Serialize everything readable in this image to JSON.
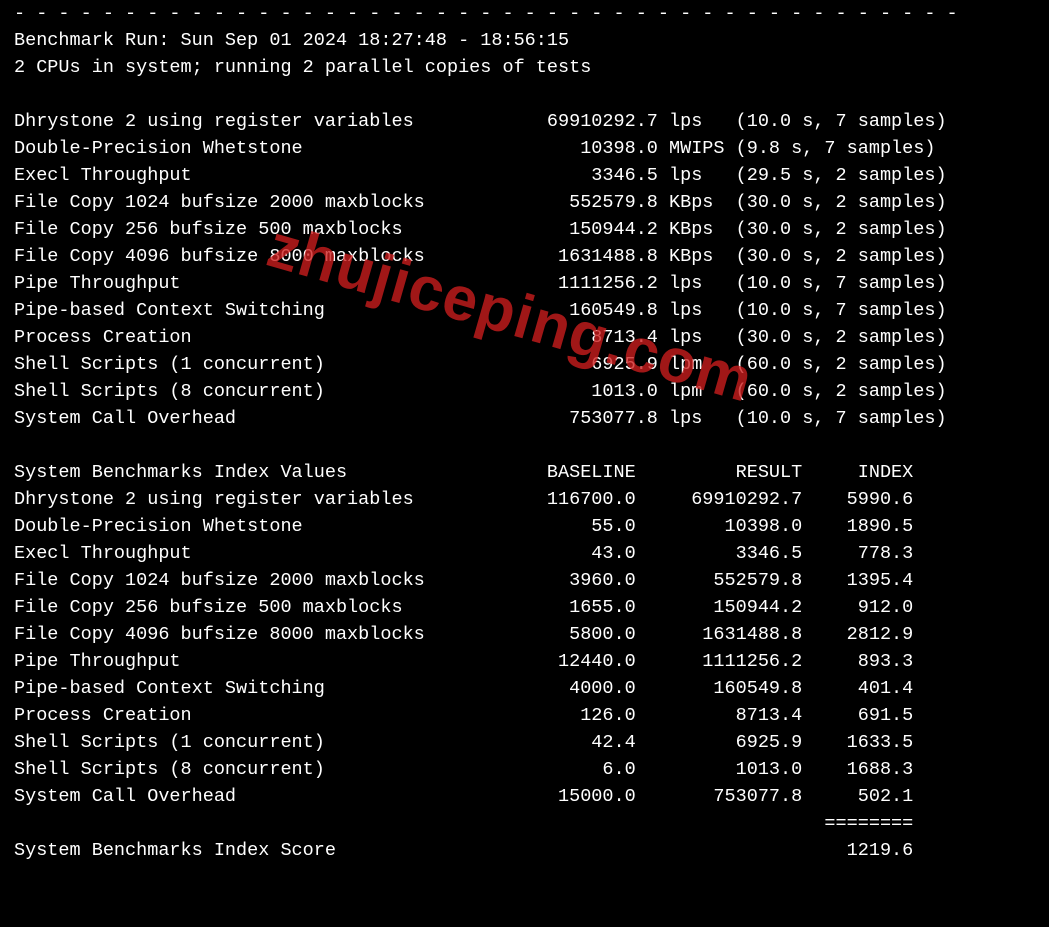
{
  "watermark": "zhujiceping.com",
  "dashes": "- - - - - - - - - - - - - - - - - - - - - - - - - - - - - - - - - - - - - - - - - - -",
  "header": {
    "run_line": "Benchmark Run: Sun Sep 01 2024 18:27:48 - 18:56:15",
    "cpu_line": "2 CPUs in system; running 2 parallel copies of tests"
  },
  "tests": [
    {
      "name": "Dhrystone 2 using register variables",
      "value": "69910292.7",
      "unit": "lps",
      "meta": "(10.0 s, 7 samples)"
    },
    {
      "name": "Double-Precision Whetstone",
      "value": "10398.0",
      "unit": "MWIPS",
      "meta": "(9.8 s, 7 samples)"
    },
    {
      "name": "Execl Throughput",
      "value": "3346.5",
      "unit": "lps",
      "meta": "(29.5 s, 2 samples)"
    },
    {
      "name": "File Copy 1024 bufsize 2000 maxblocks",
      "value": "552579.8",
      "unit": "KBps",
      "meta": "(30.0 s, 2 samples)"
    },
    {
      "name": "File Copy 256 bufsize 500 maxblocks",
      "value": "150944.2",
      "unit": "KBps",
      "meta": "(30.0 s, 2 samples)"
    },
    {
      "name": "File Copy 4096 bufsize 8000 maxblocks",
      "value": "1631488.8",
      "unit": "KBps",
      "meta": "(30.0 s, 2 samples)"
    },
    {
      "name": "Pipe Throughput",
      "value": "1111256.2",
      "unit": "lps",
      "meta": "(10.0 s, 7 samples)"
    },
    {
      "name": "Pipe-based Context Switching",
      "value": "160549.8",
      "unit": "lps",
      "meta": "(10.0 s, 7 samples)"
    },
    {
      "name": "Process Creation",
      "value": "8713.4",
      "unit": "lps",
      "meta": "(30.0 s, 2 samples)"
    },
    {
      "name": "Shell Scripts (1 concurrent)",
      "value": "6925.9",
      "unit": "lpm",
      "meta": "(60.0 s, 2 samples)"
    },
    {
      "name": "Shell Scripts (8 concurrent)",
      "value": "1013.0",
      "unit": "lpm",
      "meta": "(60.0 s, 2 samples)"
    },
    {
      "name": "System Call Overhead",
      "value": "753077.8",
      "unit": "lps",
      "meta": "(10.0 s, 7 samples)"
    }
  ],
  "index_header": {
    "title": "System Benchmarks Index Values",
    "col1": "BASELINE",
    "col2": "RESULT",
    "col3": "INDEX"
  },
  "index_rows": [
    {
      "name": "Dhrystone 2 using register variables",
      "baseline": "116700.0",
      "result": "69910292.7",
      "index": "5990.6"
    },
    {
      "name": "Double-Precision Whetstone",
      "baseline": "55.0",
      "result": "10398.0",
      "index": "1890.5"
    },
    {
      "name": "Execl Throughput",
      "baseline": "43.0",
      "result": "3346.5",
      "index": "778.3"
    },
    {
      "name": "File Copy 1024 bufsize 2000 maxblocks",
      "baseline": "3960.0",
      "result": "552579.8",
      "index": "1395.4"
    },
    {
      "name": "File Copy 256 bufsize 500 maxblocks",
      "baseline": "1655.0",
      "result": "150944.2",
      "index": "912.0"
    },
    {
      "name": "File Copy 4096 bufsize 8000 maxblocks",
      "baseline": "5800.0",
      "result": "1631488.8",
      "index": "2812.9"
    },
    {
      "name": "Pipe Throughput",
      "baseline": "12440.0",
      "result": "1111256.2",
      "index": "893.3"
    },
    {
      "name": "Pipe-based Context Switching",
      "baseline": "4000.0",
      "result": "160549.8",
      "index": "401.4"
    },
    {
      "name": "Process Creation",
      "baseline": "126.0",
      "result": "8713.4",
      "index": "691.5"
    },
    {
      "name": "Shell Scripts (1 concurrent)",
      "baseline": "42.4",
      "result": "6925.9",
      "index": "1633.5"
    },
    {
      "name": "Shell Scripts (8 concurrent)",
      "baseline": "6.0",
      "result": "1013.0",
      "index": "1688.3"
    },
    {
      "name": "System Call Overhead",
      "baseline": "15000.0",
      "result": "753077.8",
      "index": "502.1"
    }
  ],
  "score_sep": "========",
  "score": {
    "label": "System Benchmarks Index Score",
    "value": "1219.6"
  }
}
